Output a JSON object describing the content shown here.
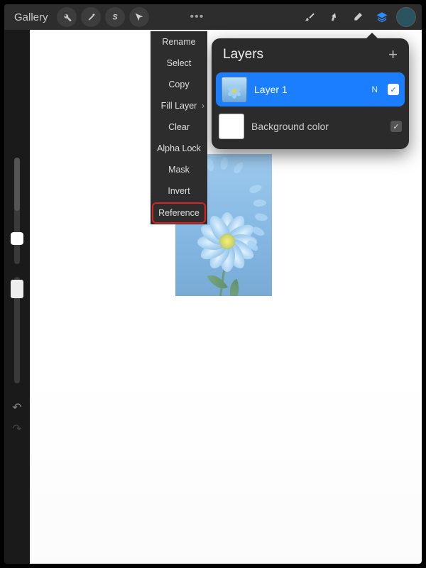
{
  "toolbar": {
    "gallery_label": "Gallery",
    "tools": {
      "actions": "wrench-icon",
      "adjustments": "wand-icon",
      "selection": "s-icon",
      "transform": "arrow-icon"
    },
    "more": "•••",
    "right": {
      "brush": "brush-icon",
      "smudge": "smudge-icon",
      "eraser": "eraser-icon",
      "layers": "layers-icon"
    },
    "color": "#2a5560"
  },
  "context_menu": {
    "items": [
      {
        "label": "Rename",
        "caret": false
      },
      {
        "label": "Select",
        "caret": false
      },
      {
        "label": "Copy",
        "caret": false
      },
      {
        "label": "Fill Layer",
        "caret": true
      },
      {
        "label": "Clear",
        "caret": false
      },
      {
        "label": "Alpha Lock",
        "caret": false
      },
      {
        "label": "Mask",
        "caret": false
      },
      {
        "label": "Invert",
        "caret": false
      },
      {
        "label": "Reference",
        "caret": false,
        "highlight": true
      }
    ]
  },
  "layers_panel": {
    "title": "Layers",
    "add": "+",
    "rows": [
      {
        "name": "Layer 1",
        "blend": "N",
        "checked": true,
        "selected": true,
        "thumb": "art"
      },
      {
        "name": "Background color",
        "blend": "",
        "checked": true,
        "selected": false,
        "thumb": "white"
      }
    ]
  },
  "sidebar": {
    "undo": "↶",
    "redo": "↷"
  }
}
